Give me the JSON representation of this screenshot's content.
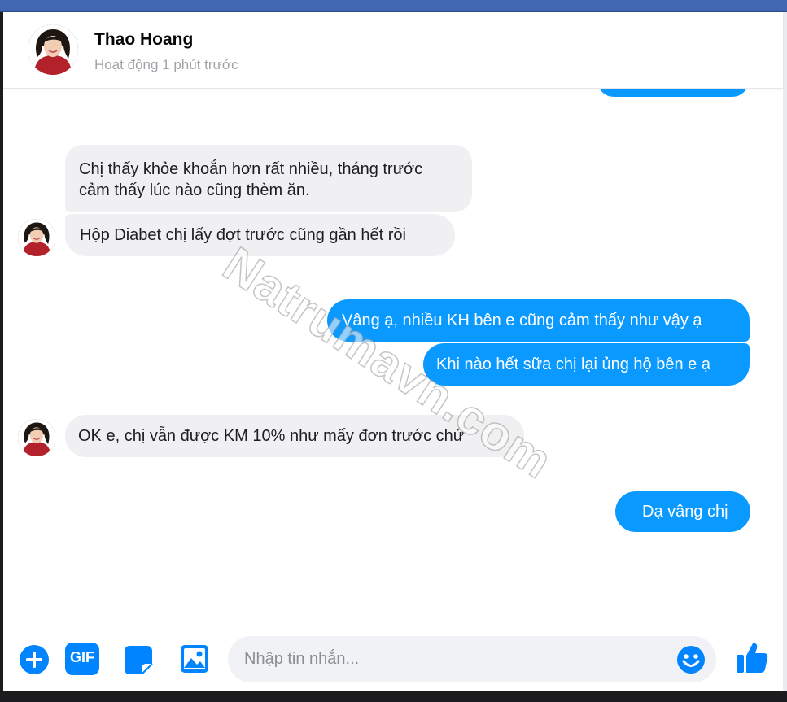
{
  "header": {
    "contact_name": "Thao Hoang",
    "status": "Hoạt động 1 phút trước"
  },
  "messages": [
    {
      "from": "contact",
      "lines": [
        "Chị thấy khỏe khoắn hơn rất nhiều, tháng trước",
        "cảm thấy lúc nào cũng thèm ăn."
      ]
    },
    {
      "from": "contact",
      "text": "Hộp Diabet chị lấy đợt trước cũng gần hết rồi"
    },
    {
      "from": "me",
      "text": "Vâng ạ, nhiều KH bên e cũng cảm thấy như vậy ạ"
    },
    {
      "from": "me",
      "text": "Khi nào hết sữa chị lại ủng hộ bên e ạ"
    },
    {
      "from": "contact",
      "text": "OK e, chị vẫn được KM 10% như mấy đơn trước chứ"
    },
    {
      "from": "me",
      "text": "Dạ vâng chị"
    }
  ],
  "composer": {
    "placeholder": "Nhập tin nhắn...",
    "gif_label": "GIF",
    "icons": [
      "plus-icon",
      "gif-icon",
      "sticker-icon",
      "image-icon",
      "emoji-icon",
      "thumbs-up-icon"
    ]
  },
  "watermark": "Natrumavn.com",
  "colors": {
    "accent": "#0a99ff",
    "incoming_bubble": "#f0eff1",
    "top_bar": "#4267b2",
    "icon_blue": "#0084ff"
  }
}
